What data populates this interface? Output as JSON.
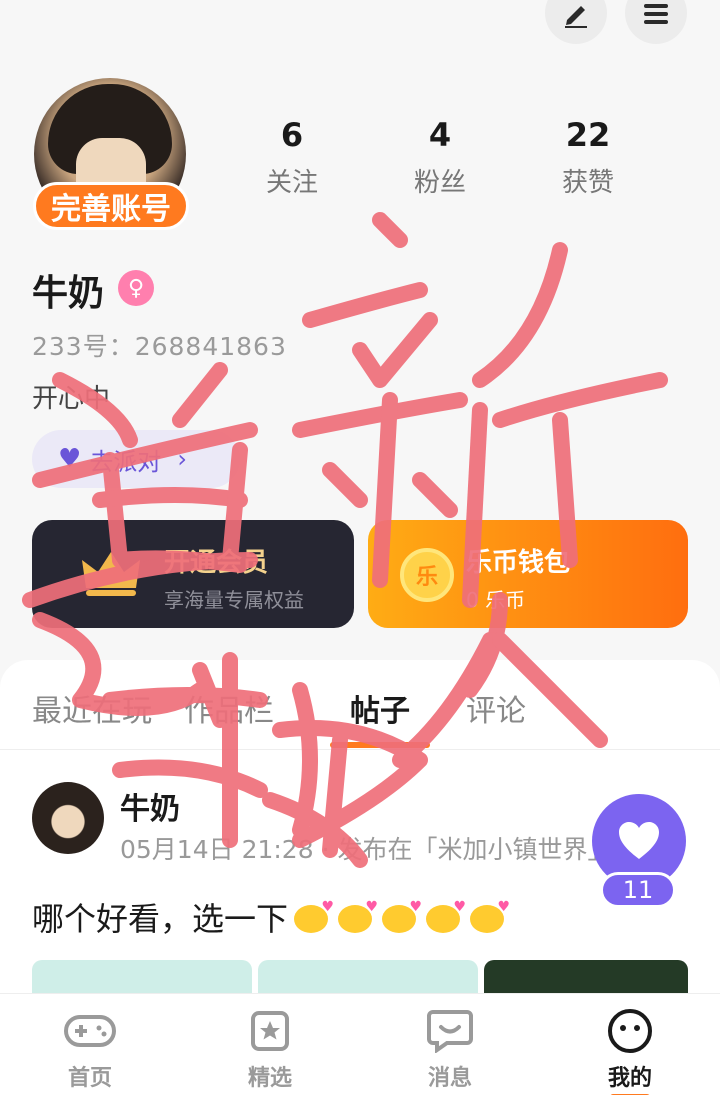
{
  "profile": {
    "complete_badge": "完善账号",
    "name": "牛奶",
    "gender_symbol": "♀",
    "uid": "233号：268841863",
    "bio": "开心中",
    "party_label": "去派对",
    "party_arrow": "›"
  },
  "stats": [
    {
      "num": "6",
      "label": "关注"
    },
    {
      "num": "4",
      "label": "粉丝"
    },
    {
      "num": "22",
      "label": "获赞"
    }
  ],
  "cards": {
    "vip": {
      "title": "开通会员",
      "sub": "享海量专属权益"
    },
    "wallet": {
      "title": "乐币钱包",
      "sub": "0 乐币",
      "coin": "乐"
    }
  },
  "tabs": [
    "最近在玩",
    "作品栏",
    "帖子",
    "评论"
  ],
  "post": {
    "author": "牛奶",
    "meta": "05月14日 21:28 · 发布在「米加小镇世界」",
    "text": "哪个好看，选一下",
    "like_count": "11"
  },
  "nav": [
    {
      "label": "首页",
      "icon": "gamepad-icon"
    },
    {
      "label": "精选",
      "icon": "star-icon"
    },
    {
      "label": "消息",
      "icon": "chat-icon"
    },
    {
      "label": "我的",
      "icon": "smile-face-icon"
    }
  ],
  "annotation": {
    "text": "首新拔人",
    "color": "#ef6f7a"
  },
  "colors": {
    "accent": "#ff7a1f",
    "purple": "#7c64f0"
  }
}
